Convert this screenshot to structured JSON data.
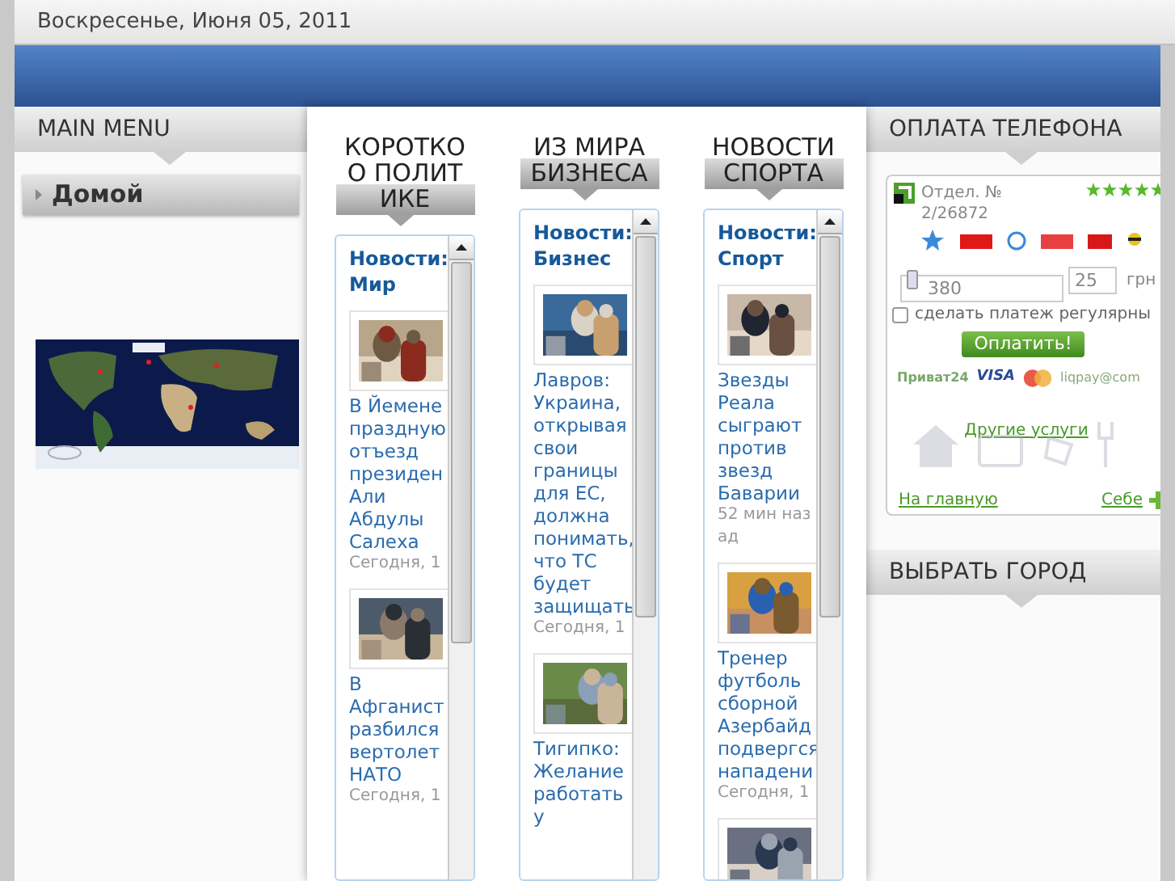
{
  "date": "Воскресенье, Июня 05, 2011",
  "left": {
    "menu_title": "MAIN MENU",
    "menu_items": [
      {
        "label": "Домой"
      }
    ],
    "map": {
      "kind": "picture"
    }
  },
  "news_columns": [
    {
      "heading": "КОРОТКО О ПОЛИТИКЕ",
      "title": "Новости: Мир",
      "items": [
        {
          "kind": "story",
          "headline": "В Йемене праздную отъезд президен Али Абдулы Салеха",
          "time": "Сегодня, 1"
        },
        {
          "kind": "story",
          "headline": "В Афганист разбился вертолет НАТО",
          "time": "Сегодня, 1"
        }
      ]
    },
    {
      "heading": "ИЗ МИРА БИЗНЕСА",
      "title": "Новости: Бизнес",
      "items": [
        {
          "kind": "story",
          "headline": "Лавров: Украина, открывая свои границы для ЕС, должна понимать, что ТС будет защищать",
          "time": "Сегодня, 1"
        },
        {
          "kind": "story",
          "headline": "Тигипко: Желание работать у"
        }
      ]
    },
    {
      "heading": "НОВОСТИ СПОРТА",
      "title": "Новости: Спорт",
      "items": [
        {
          "kind": "story",
          "headline": "Звезды Реала сыграют против звезд Баварии",
          "time": "52 мин назад"
        },
        {
          "kind": "story",
          "headline": "Тренер футболь сборной Азербайд подвергся нападени",
          "time": "Сегодня, 1"
        },
        {
          "kind": "picture"
        }
      ]
    }
  ],
  "payment": {
    "title": "ОПЛАТА ТЕЛЕФОНА",
    "branch_label": "Отдел. №",
    "branch_number": "2/26872",
    "stars": 5,
    "phone": "380",
    "amount": "25",
    "currency": "грн",
    "regular": {
      "label": "сделать платеж регулярны",
      "checked": false
    },
    "pay_button": "Оплатить!",
    "payment_logos": [
      "Приват24",
      "VISA",
      "liqpay@com"
    ],
    "other_link": "Другие услуги",
    "home_link": "На главную",
    "self_link": "Себе"
  },
  "city_title": "ВЫБРАТЬ ГОРОД"
}
